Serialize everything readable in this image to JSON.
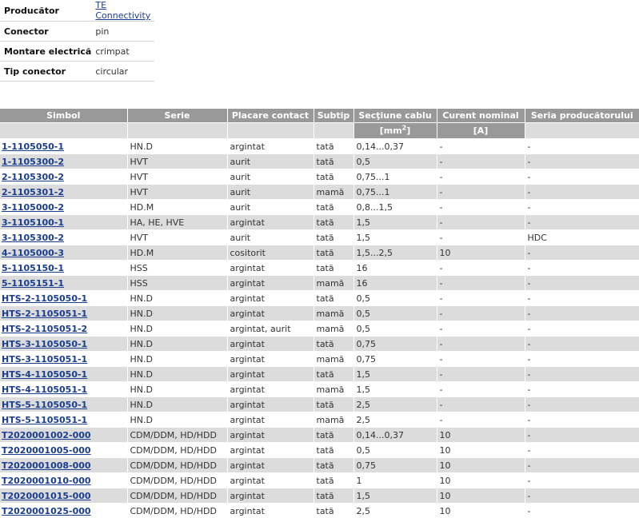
{
  "attributes": [
    {
      "key": "Producător",
      "value": "TE Connectivity",
      "link": true
    },
    {
      "key": "Conector",
      "value": "pin",
      "link": false
    },
    {
      "key": "Montare electrică",
      "value": "crimpat",
      "link": false
    },
    {
      "key": "Tip conector",
      "value": "circular",
      "link": false
    }
  ],
  "table": {
    "headers": [
      "Simbol",
      "Serie",
      "Placare contact",
      "Subtip",
      "Secţiune cablu",
      "Curent nominal",
      "Seria producătorului"
    ],
    "units": {
      "sectiune_prefix": "[mm",
      "sectiune_sup": "2",
      "sectiune_suffix": "]",
      "curent": "[A]"
    },
    "rows": [
      [
        "1-1105050-1",
        "HN.D",
        "argintat",
        "tată",
        "0,14...0,37",
        "-",
        "-"
      ],
      [
        "1-1105300-2",
        "HVT",
        "aurit",
        "tată",
        "0,5",
        "-",
        "-"
      ],
      [
        "2-1105300-2",
        "HVT",
        "aurit",
        "tată",
        "0,75...1",
        "-",
        "-"
      ],
      [
        "2-1105301-2",
        "HVT",
        "aurit",
        "mamă",
        "0,75...1",
        "-",
        "-"
      ],
      [
        "3-1105000-2",
        "HD.M",
        "aurit",
        "tată",
        "0,8...1,5",
        "-",
        "-"
      ],
      [
        "3-1105100-1",
        "HA, HE, HVE",
        "argintat",
        "tată",
        "1,5",
        "-",
        "-"
      ],
      [
        "3-1105300-2",
        "HVT",
        "aurit",
        "tată",
        "1,5",
        "-",
        "HDC"
      ],
      [
        "4-1105000-3",
        "HD.M",
        "cositorit",
        "tată",
        "1,5...2,5",
        "10",
        "-"
      ],
      [
        "5-1105150-1",
        "HSS",
        "argintat",
        "tată",
        "16",
        "-",
        "-"
      ],
      [
        "5-1105151-1",
        "HSS",
        "argintat",
        "mamă",
        "16",
        "-",
        "-"
      ],
      [
        "HTS-2-1105050-1",
        "HN.D",
        "argintat",
        "tată",
        "0,5",
        "-",
        "-"
      ],
      [
        "HTS-2-1105051-1",
        "HN.D",
        "argintat",
        "mamă",
        "0,5",
        "-",
        "-"
      ],
      [
        "HTS-2-1105051-2",
        "HN.D",
        "argintat, aurit",
        "mamă",
        "0,5",
        "-",
        "-"
      ],
      [
        "HTS-3-1105050-1",
        "HN.D",
        "argintat",
        "tată",
        "0,75",
        "-",
        "-"
      ],
      [
        "HTS-3-1105051-1",
        "HN.D",
        "argintat",
        "mamă",
        "0,75",
        "-",
        "-"
      ],
      [
        "HTS-4-1105050-1",
        "HN.D",
        "argintat",
        "tată",
        "1,5",
        "-",
        "-"
      ],
      [
        "HTS-4-1105051-1",
        "HN.D",
        "argintat",
        "mamă",
        "1,5",
        "-",
        "-"
      ],
      [
        "HTS-5-1105050-1",
        "HN.D",
        "argintat",
        "tată",
        "2,5",
        "-",
        "-"
      ],
      [
        "HTS-5-1105051-1",
        "HN.D",
        "argintat",
        "mamă",
        "2,5",
        "-",
        "-"
      ],
      [
        "T2020001002-000",
        "CDM/DDM, HD/HDD",
        "argintat",
        "tată",
        "0,14...0,37",
        "10",
        "-"
      ],
      [
        "T2020001005-000",
        "CDM/DDM, HD/HDD",
        "argintat",
        "tată",
        "0,5",
        "10",
        "-"
      ],
      [
        "T2020001008-000",
        "CDM/DDM, HD/HDD",
        "argintat",
        "tată",
        "0,75",
        "10",
        "-"
      ],
      [
        "T2020001010-000",
        "CDM/DDM, HD/HDD",
        "argintat",
        "tată",
        "1",
        "10",
        "-"
      ],
      [
        "T2020001015-000",
        "CDM/DDM, HD/HDD",
        "argintat",
        "tată",
        "1,5",
        "10",
        "-"
      ],
      [
        "T2020001025-000",
        "CDM/DDM, HD/HDD",
        "argintat",
        "tată",
        "2,5",
        "10",
        "-"
      ]
    ]
  },
  "colors": {
    "header_bg": "#999999",
    "row_alt_bg": "#dcdcdc",
    "link": "#1a3d8f"
  }
}
